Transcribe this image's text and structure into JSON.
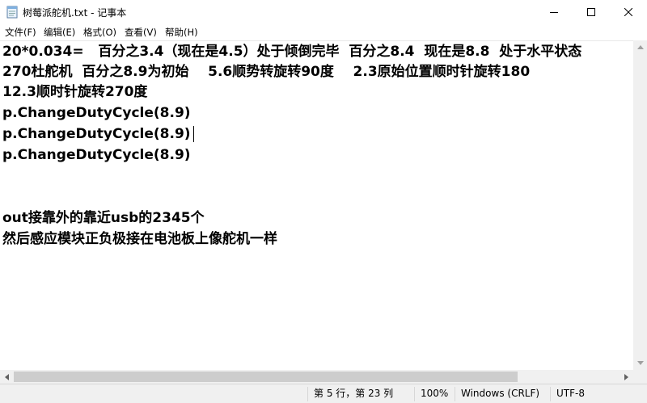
{
  "window": {
    "title": "树莓派舵机.txt - 记事本"
  },
  "menu": {
    "file": "文件(F)",
    "edit": "编辑(E)",
    "format": "格式(O)",
    "view": "查看(V)",
    "help": "帮助(H)"
  },
  "editor": {
    "lines": [
      "20*0.034=   百分之3.4（现在是4.5）处于倾倒完毕  百分之8.4  现在是8.8  处于水平状态",
      "270杜舵机  百分之8.9为初始    5.6顺势转旋转90度    2.3原始位置顺时针旋转180",
      "12.3顺时针旋转270度",
      "p.ChangeDutyCycle(8.9)",
      "p.ChangeDutyCycle(8.9)",
      "p.ChangeDutyCycle(8.9)",
      "",
      "",
      "out接靠外的靠近usb的2345个",
      "然后感应模块正负极接在电池板上像舵机一样"
    ]
  },
  "status": {
    "position": "第 5 行，第 23 列",
    "zoom": "100%",
    "line_ending": "Windows (CRLF)",
    "encoding": "UTF-8"
  },
  "icons": {
    "app": "notepad-icon",
    "minimize": "minimize-icon",
    "maximize": "maximize-icon",
    "close": "close-icon"
  }
}
